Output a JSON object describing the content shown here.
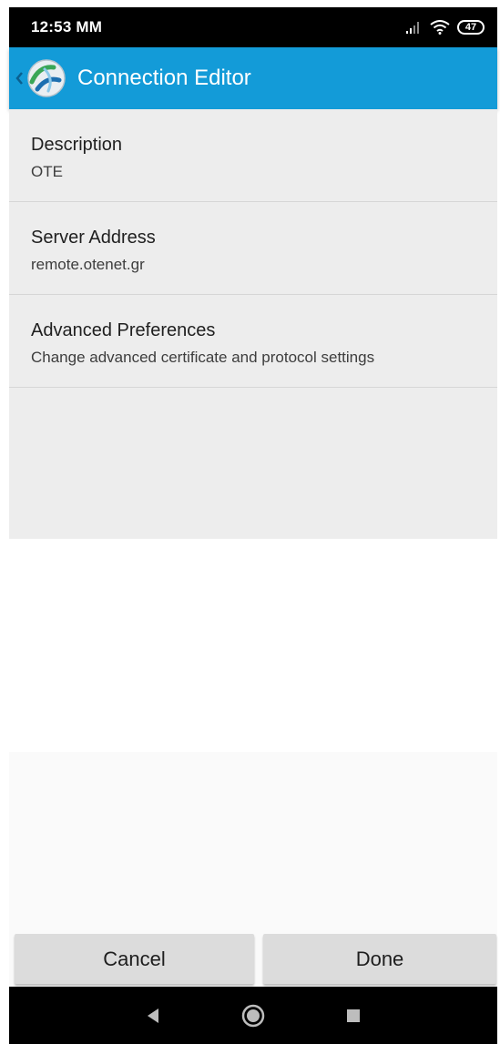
{
  "status_bar": {
    "time": "12:53 MM",
    "battery": "47",
    "icons": [
      "signal-icon",
      "wifi-icon",
      "battery-icon"
    ]
  },
  "app_bar": {
    "title": "Connection Editor",
    "icons": [
      "back-chevron-icon",
      "app-logo-icon"
    ],
    "color": "#139bd8"
  },
  "preferences": [
    {
      "title": "Description",
      "value": "OTE"
    },
    {
      "title": "Server Address",
      "value": "remote.otenet.gr"
    },
    {
      "title": "Advanced Preferences",
      "value": "Change advanced certificate and protocol settings"
    }
  ],
  "buttons": {
    "cancel": "Cancel",
    "done": "Done"
  },
  "nav_bar": {
    "icons": [
      "back-triangle-icon",
      "home-circle-icon",
      "recents-square-icon"
    ]
  }
}
